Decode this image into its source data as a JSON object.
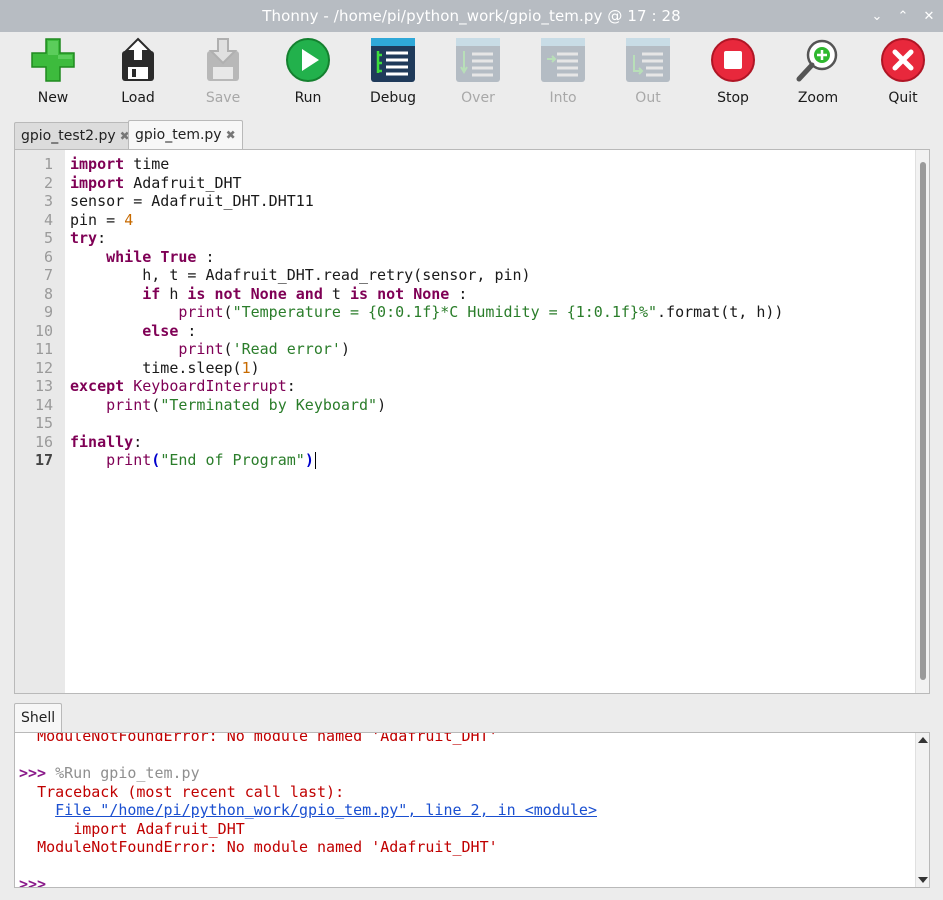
{
  "window": {
    "title": "Thonny  -  /home/pi/python_work/gpio_tem.py  @  17 : 28",
    "controls": [
      "chevron-down",
      "chevron-up",
      "close"
    ]
  },
  "toolbar": {
    "buttons": [
      {
        "label": "New",
        "icon": "new-file-icon",
        "enabled": true
      },
      {
        "label": "Load",
        "icon": "load-file-icon",
        "enabled": true
      },
      {
        "label": "Save",
        "icon": "save-file-icon",
        "enabled": false
      },
      {
        "label": "Run",
        "icon": "run-icon",
        "enabled": true
      },
      {
        "label": "Debug",
        "icon": "debug-icon",
        "enabled": true
      },
      {
        "label": "Over",
        "icon": "step-over-icon",
        "enabled": false
      },
      {
        "label": "Into",
        "icon": "step-into-icon",
        "enabled": false
      },
      {
        "label": "Out",
        "icon": "step-out-icon",
        "enabled": false
      },
      {
        "label": "Stop",
        "icon": "stop-icon",
        "enabled": true
      },
      {
        "label": "Zoom",
        "icon": "zoom-icon",
        "enabled": true
      },
      {
        "label": "Quit",
        "icon": "quit-icon",
        "enabled": true
      }
    ]
  },
  "tabs": [
    {
      "label": "gpio_test2.py",
      "close": "✖",
      "active": false
    },
    {
      "label": "gpio_tem.py",
      "close": "✖",
      "active": true
    }
  ],
  "editor": {
    "current_line": 17,
    "line_numbers": [
      "1",
      "2",
      "3",
      "4",
      "5",
      "6",
      "7",
      "8",
      "9",
      "10",
      "11",
      "12",
      "13",
      "14",
      "15",
      "16",
      "17"
    ],
    "lines": [
      "import time",
      "import Adafruit_DHT",
      "sensor = Adafruit_DHT.DHT11",
      "pin = 4",
      "try:",
      "    while True :",
      "        h, t = Adafruit_DHT.read_retry(sensor, pin)",
      "        if h is not None and t is not None :",
      "            print(\"Temperature = {0:0.1f}*C Humidity = {1:0.1f}%\".format(t, h))",
      "        else :",
      "            print('Read error')",
      "        time.sleep(1)",
      "except KeyboardInterrupt:",
      "    print(\"Terminated by Keyboard\")",
      "",
      "finally:",
      "    print(\"End of Program\")"
    ]
  },
  "shell": {
    "tab_label": "Shell",
    "lines": [
      {
        "kind": "error",
        "text": "ModuleNotFoundError: No module named 'Adafruit_DHT'"
      },
      {
        "kind": "blank",
        "text": ""
      },
      {
        "kind": "prompt",
        "prompt": ">>>",
        "text": " %Run gpio_tem.py"
      },
      {
        "kind": "error",
        "text": "Traceback (most recent call last):"
      },
      {
        "kind": "link",
        "text": "File \"/home/pi/python_work/gpio_tem.py\", line 2, in <module>"
      },
      {
        "kind": "error-indent",
        "text": "import Adafruit_DHT"
      },
      {
        "kind": "error",
        "text": "ModuleNotFoundError: No module named 'Adafruit_DHT'"
      },
      {
        "kind": "blank",
        "text": ""
      },
      {
        "kind": "prompt",
        "prompt": ">>>",
        "text": ""
      }
    ]
  }
}
